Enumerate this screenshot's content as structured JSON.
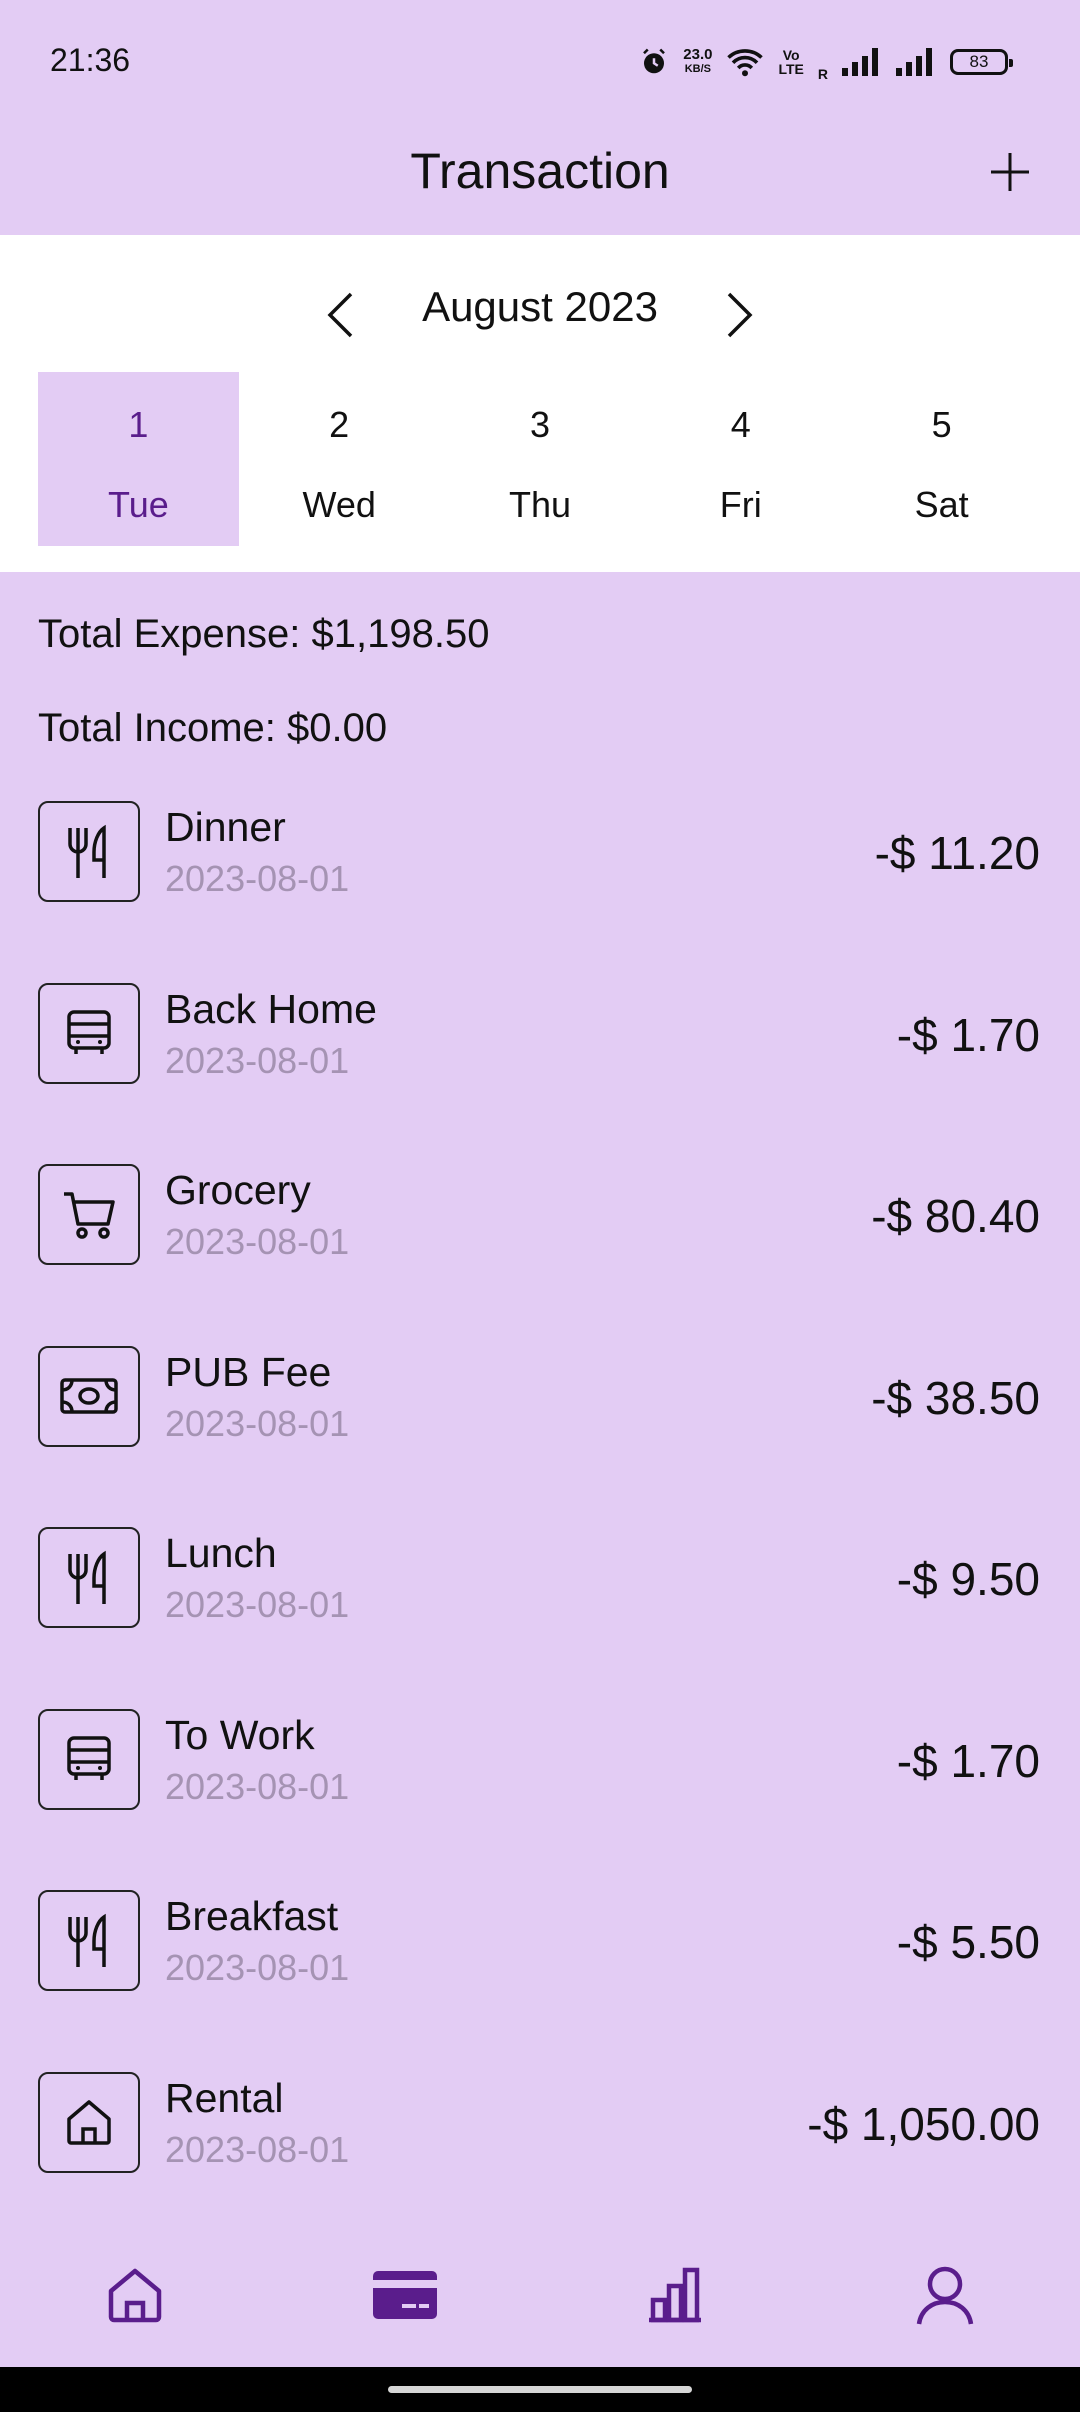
{
  "status_bar": {
    "time": "21:36",
    "net_speed": "23.0",
    "net_unit": "KB/S",
    "volte": "Vo",
    "lte": "LTE",
    "roaming": "R",
    "battery": "83"
  },
  "header": {
    "title": "Transaction",
    "add_icon": "plus-icon"
  },
  "calendar": {
    "month_label": "August 2023",
    "days": [
      {
        "num": "1",
        "name": "Tue",
        "selected": true
      },
      {
        "num": "2",
        "name": "Wed",
        "selected": false
      },
      {
        "num": "3",
        "name": "Thu",
        "selected": false
      },
      {
        "num": "4",
        "name": "Fri",
        "selected": false
      },
      {
        "num": "5",
        "name": "Sat",
        "selected": false
      }
    ]
  },
  "totals": {
    "expense": "Total Expense: $1,198.50",
    "income": "Total Income: $0.00"
  },
  "transactions": [
    {
      "title": "Dinner",
      "date": "2023-08-01",
      "amount": "-$ 11.20",
      "icon": "utensils-icon"
    },
    {
      "title": "Back Home",
      "date": "2023-08-01",
      "amount": "-$ 1.70",
      "icon": "bus-icon"
    },
    {
      "title": "Grocery",
      "date": "2023-08-01",
      "amount": "-$ 80.40",
      "icon": "cart-icon"
    },
    {
      "title": "PUB Fee",
      "date": "2023-08-01",
      "amount": "-$ 38.50",
      "icon": "cash-icon"
    },
    {
      "title": "Lunch",
      "date": "2023-08-01",
      "amount": "-$ 9.50",
      "icon": "utensils-icon"
    },
    {
      "title": "To Work",
      "date": "2023-08-01",
      "amount": "-$ 1.70",
      "icon": "bus-icon"
    },
    {
      "title": "Breakfast",
      "date": "2023-08-01",
      "amount": "-$ 5.50",
      "icon": "utensils-icon"
    },
    {
      "title": "Rental",
      "date": "2023-08-01",
      "amount": "-$ 1,050.00",
      "icon": "house-icon"
    }
  ],
  "bottom_nav": [
    {
      "icon": "home-icon",
      "active": false
    },
    {
      "icon": "card-icon",
      "active": true
    },
    {
      "icon": "chart-icon",
      "active": false
    },
    {
      "icon": "profile-icon",
      "active": false
    }
  ],
  "colors": {
    "background": "#e3ccf4",
    "accent": "#5a1d8c",
    "date_text": "#a593b3"
  }
}
